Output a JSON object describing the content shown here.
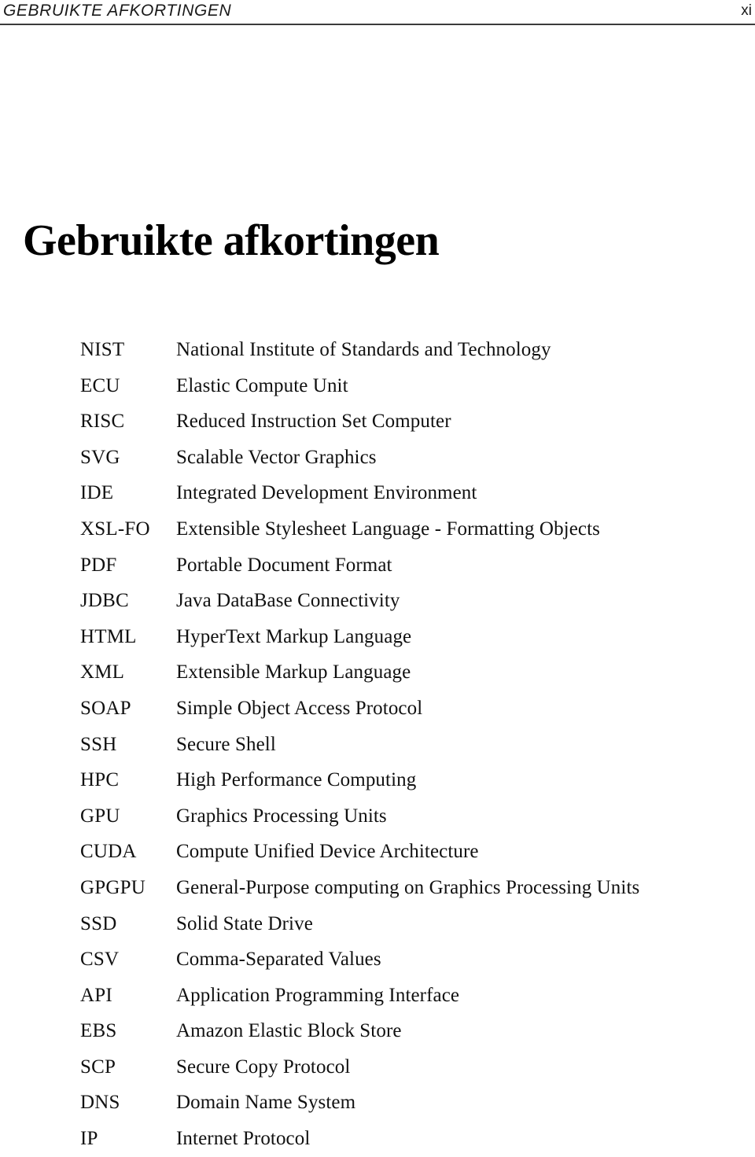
{
  "page": {
    "running_head": "GEBRUIKTE AFKORTINGEN",
    "folio": "xi",
    "title": "Gebruikte afkortingen",
    "text_color": "#111111",
    "rule_color": "#3b3b3b",
    "background_color": "#ffffff"
  },
  "abbreviations": [
    {
      "term": "NIST",
      "description": "National Institute of Standards and Technology"
    },
    {
      "term": "ECU",
      "description": "Elastic Compute Unit"
    },
    {
      "term": "RISC",
      "description": "Reduced Instruction Set Computer"
    },
    {
      "term": "SVG",
      "description": "Scalable Vector Graphics"
    },
    {
      "term": "IDE",
      "description": "Integrated Development Environment"
    },
    {
      "term": "XSL-FO",
      "description": "Extensible Stylesheet Language - Formatting Objects"
    },
    {
      "term": "PDF",
      "description": "Portable Document Format"
    },
    {
      "term": "JDBC",
      "description": "Java DataBase Connectivity"
    },
    {
      "term": "HTML",
      "description": "HyperText Markup Language"
    },
    {
      "term": "XML",
      "description": "Extensible Markup Language"
    },
    {
      "term": "SOAP",
      "description": "Simple Object Access Protocol"
    },
    {
      "term": "SSH",
      "description": "Secure Shell"
    },
    {
      "term": "HPC",
      "description": "High Performance Computing"
    },
    {
      "term": "GPU",
      "description": "Graphics Processing Units"
    },
    {
      "term": "CUDA",
      "description": "Compute Unified Device Architecture"
    },
    {
      "term": "GPGPU",
      "description": "General-Purpose computing on Graphics Processing Units"
    },
    {
      "term": "SSD",
      "description": "Solid State Drive"
    },
    {
      "term": "CSV",
      "description": "Comma-Separated Values"
    },
    {
      "term": "API",
      "description": "Application Programming Interface"
    },
    {
      "term": "EBS",
      "description": "Amazon Elastic Block Store"
    },
    {
      "term": "SCP",
      "description": "Secure Copy Protocol"
    },
    {
      "term": "DNS",
      "description": "Domain Name System"
    },
    {
      "term": "IP",
      "description": "Internet Protocol"
    }
  ]
}
